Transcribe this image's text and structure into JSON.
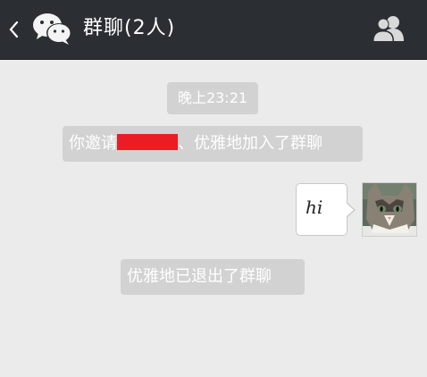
{
  "header": {
    "title": "群聊(2人)",
    "back_icon": "chevron-left-icon",
    "app_icon": "wechat-logo-icon",
    "members_icon": "group-members-icon"
  },
  "messages": {
    "timestamp": "晚上23:21",
    "invite_prefix": "你邀请",
    "invite_suffix": "、优雅地加入了群聊",
    "chat_text": "hi",
    "left_notice": "优雅地已退出了群聊"
  },
  "colors": {
    "header_bg": "#2b2f33",
    "chat_bg": "#ebebeb",
    "system_bubble": "#d2d2d2",
    "redaction": "#ec1c24"
  }
}
